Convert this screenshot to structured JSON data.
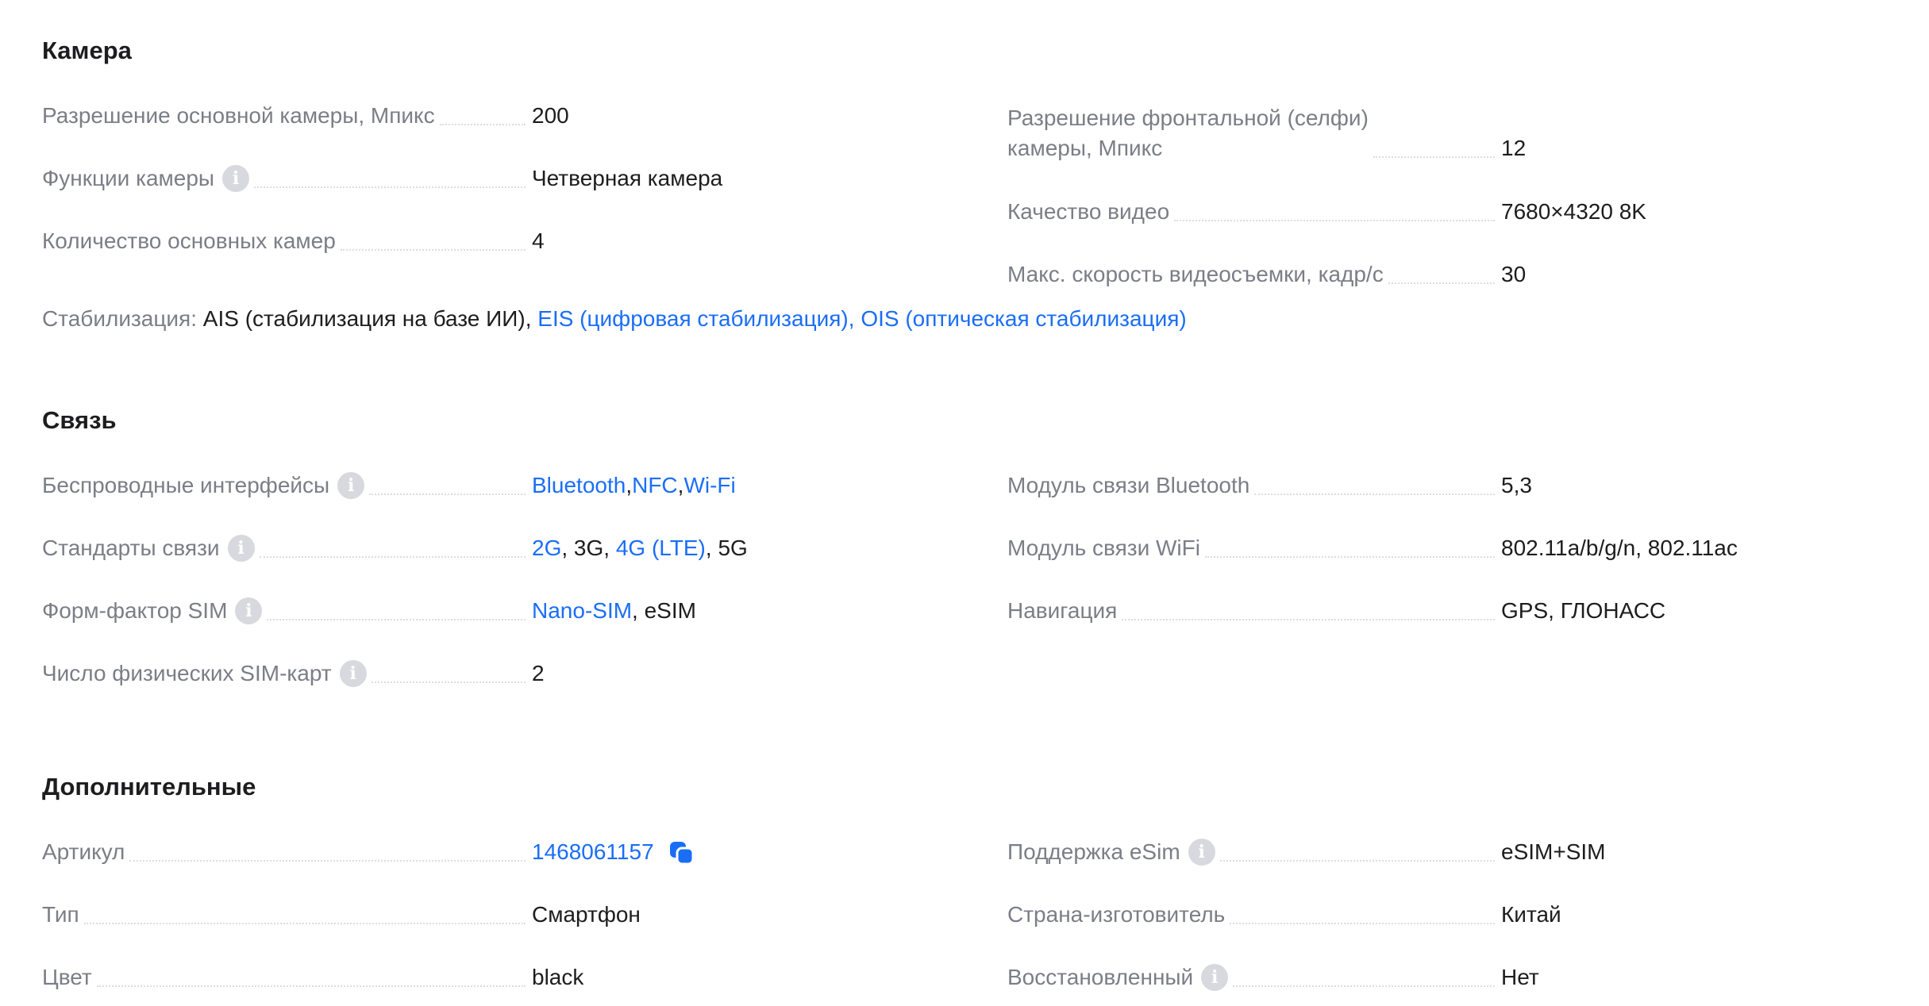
{
  "camera": {
    "title": "Камера",
    "main_res_label": "Разрешение основной камеры, Мпикс",
    "main_res_value": "200",
    "functions_label": "Функции камеры",
    "functions_value": "Четверная камера",
    "count_label": "Количество основных камер",
    "count_value": "4",
    "front_label_1": "Разрешение фронтальной (селфи)",
    "front_label_2": "камеры, Мпикс",
    "front_value": "12",
    "video_label": "Качество видео",
    "video_value": "7680×4320 8K",
    "fps_label": "Макс. скорость видеосъемки, кадр/с",
    "fps_value": "30",
    "stab_label": "Стабилизация:",
    "stab_plain": "AIS (стабилизация на базе ИИ),",
    "stab_link1": "EIS (цифровая стабилизация),",
    "stab_link2": "OIS (оптическая стабилизация)"
  },
  "connection": {
    "title": "Связь",
    "wireless_label": "Беспроводные интерфейсы",
    "wireless_v1": "Bluetooth",
    "wireless_sep1": ", ",
    "wireless_v2": "NFC",
    "wireless_sep2": ", ",
    "wireless_v3": "Wi-Fi",
    "standards_label": "Стандарты связи",
    "standards_v1": "2G",
    "standards_t1": ", 3G, ",
    "standards_v2": "4G (LTE)",
    "standards_t2": ", 5G",
    "sim_label": "Форм-фактор SIM",
    "sim_v1": "Nano-SIM",
    "sim_t1": ", eSIM",
    "phys_sim_label": "Число физических SIM-карт",
    "phys_sim_value": "2",
    "bt_label": "Модуль связи Bluetooth",
    "bt_value": "5,3",
    "wifi_label": "Модуль связи WiFi",
    "wifi_value": "802.11a/b/g/n, 802.11ac",
    "nav_label": "Навигация",
    "nav_value": "GPS, ГЛОНАСС"
  },
  "extra": {
    "title": "Дополнительные",
    "article_label": "Артикул",
    "article_value": "1468061157",
    "type_label": "Тип",
    "type_value": "Смартфон",
    "color_label": "Цвет",
    "color_value": "black",
    "esim_label": "Поддержка eSim",
    "esim_value": "eSIM+SIM",
    "country_label": "Страна-изготовитель",
    "country_value": "Китай",
    "refurb_label": "Восстановленный",
    "refurb_value": "Нет"
  },
  "icons": {
    "info": "info-icon",
    "copy": "copy-icon"
  },
  "colors": {
    "link": "#1a6ef5",
    "label": "#7b7e86",
    "text": "#1d1d1f",
    "info_bg": "#d7d9de"
  }
}
